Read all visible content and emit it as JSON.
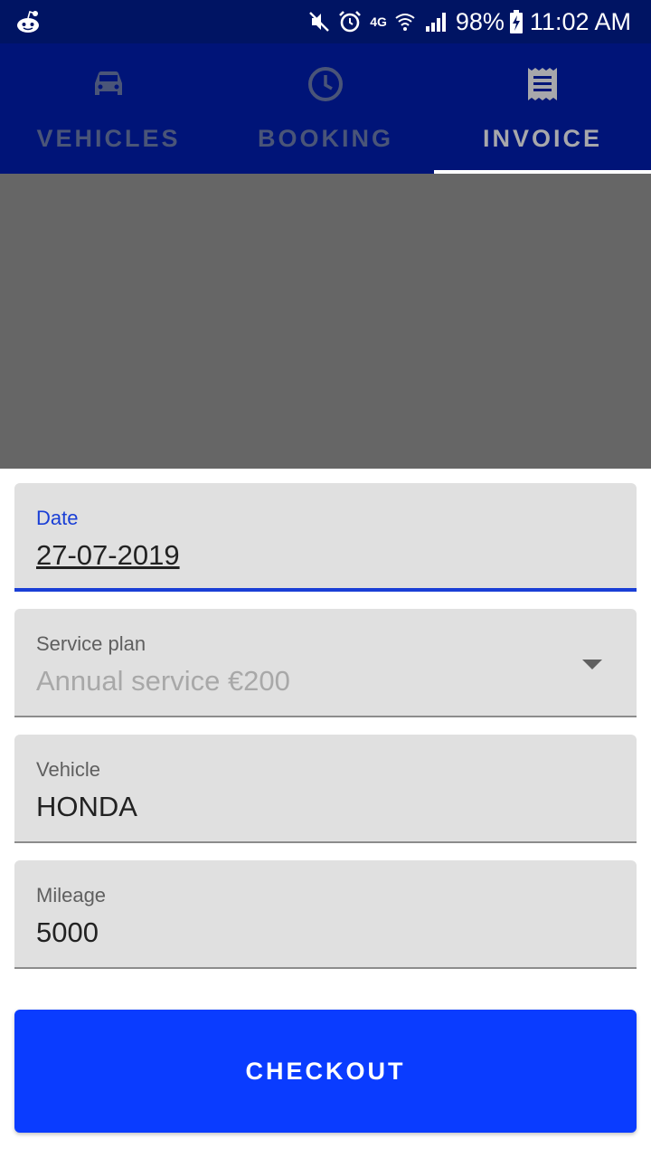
{
  "status_bar": {
    "network": "4G",
    "battery_percent": "98%",
    "time": "11:02 AM",
    "icons": [
      "reddit-icon",
      "mute-icon",
      "alarm-icon",
      "wifi-icon",
      "signal-icon",
      "battery-charging-icon"
    ]
  },
  "tabs": [
    {
      "label": "VEHICLES",
      "icon": "car-icon",
      "active": false
    },
    {
      "label": "BOOKING",
      "icon": "clock-icon",
      "active": false
    },
    {
      "label": "INVOICE",
      "icon": "receipt-icon",
      "active": true
    }
  ],
  "form": {
    "date": {
      "label": "Date",
      "value": "27-07-2019"
    },
    "service_plan": {
      "label": "Service plan",
      "value": "Annual service €200"
    },
    "vehicle": {
      "label": "Vehicle",
      "value": "HONDA"
    },
    "mileage": {
      "label": "Mileage",
      "value": "5000"
    }
  },
  "checkout_label": "CHECKOUT",
  "colors": {
    "status_bar": "#001463",
    "tab_bar": "#001478",
    "accent": "#0a3cff",
    "focus": "#1a3fd6"
  }
}
